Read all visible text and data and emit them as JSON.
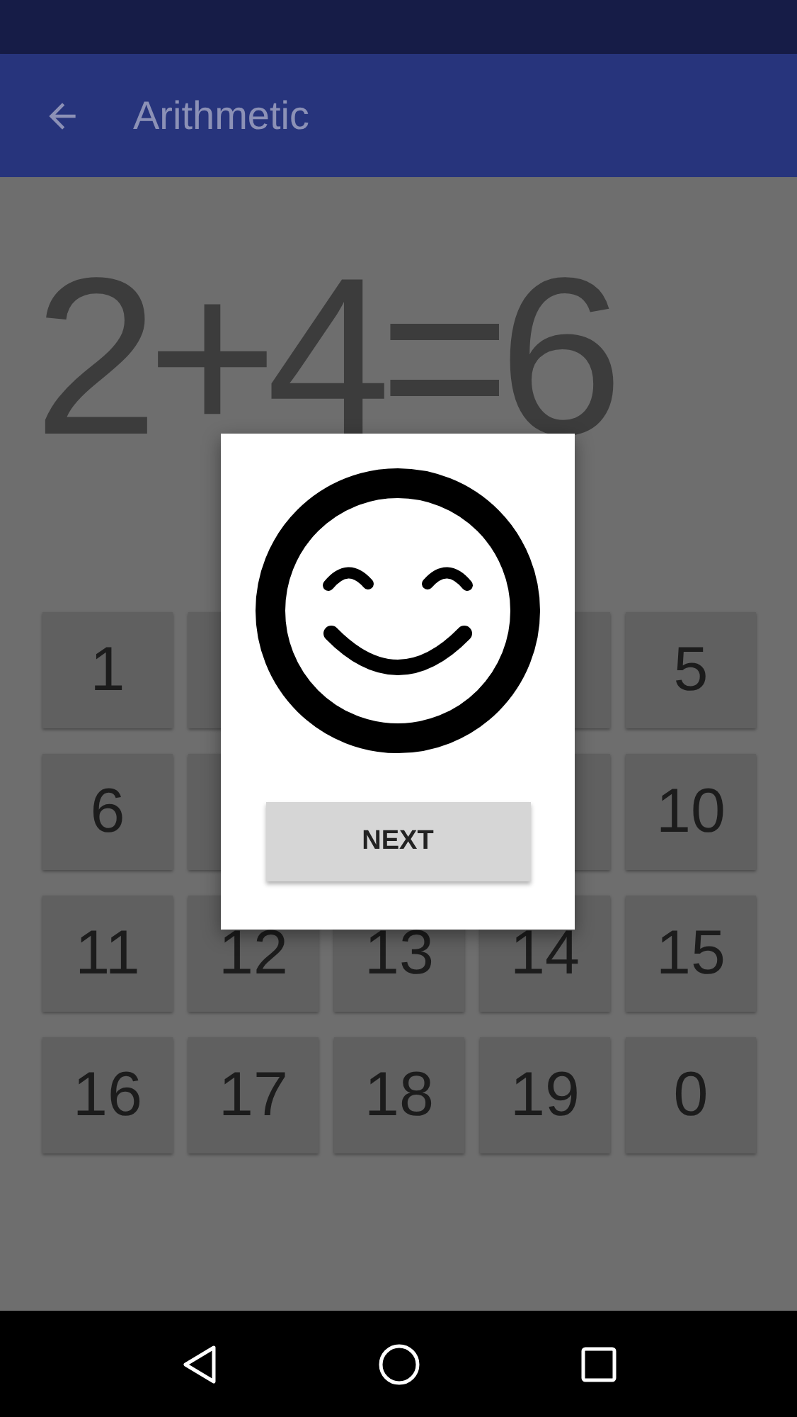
{
  "app_bar": {
    "title": "Arithmetic"
  },
  "equation": "2+4=6",
  "keys": [
    {
      "kind": "number",
      "label": "1"
    },
    {
      "kind": "covered"
    },
    {
      "kind": "spacer"
    },
    {
      "kind": "covered"
    },
    {
      "kind": "number",
      "label": "5"
    },
    {
      "kind": "number",
      "label": "6"
    },
    {
      "kind": "covered"
    },
    {
      "kind": "spacer"
    },
    {
      "kind": "covered"
    },
    {
      "kind": "number",
      "label": "10"
    },
    {
      "kind": "number",
      "label": "11"
    },
    {
      "kind": "number",
      "label": "12"
    },
    {
      "kind": "number",
      "label": "13"
    },
    {
      "kind": "number",
      "label": "14"
    },
    {
      "kind": "number",
      "label": "15"
    },
    {
      "kind": "number",
      "label": "16"
    },
    {
      "kind": "number",
      "label": "17"
    },
    {
      "kind": "number",
      "label": "18"
    },
    {
      "kind": "number",
      "label": "19"
    },
    {
      "kind": "number",
      "label": "0"
    }
  ],
  "dialog": {
    "button": "NEXT"
  }
}
